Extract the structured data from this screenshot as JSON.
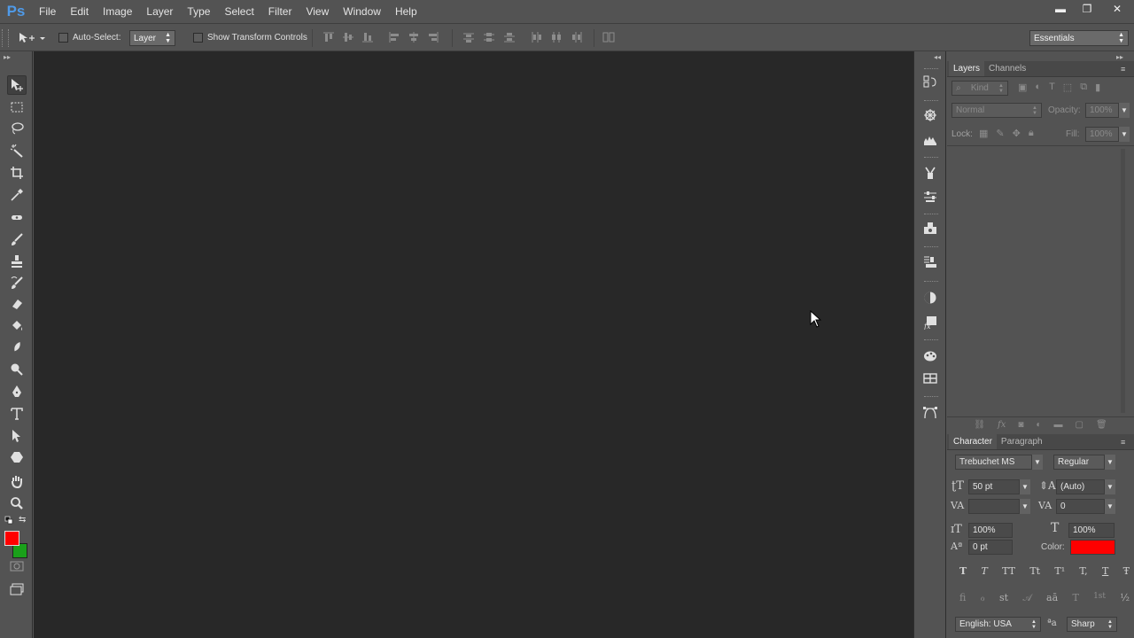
{
  "app": {
    "logo": "Ps"
  },
  "menu": [
    "File",
    "Edit",
    "Image",
    "Layer",
    "Type",
    "Select",
    "Filter",
    "View",
    "Window",
    "Help"
  ],
  "window_controls": {
    "minimize": "▬",
    "restore": "❐",
    "close": "✕"
  },
  "options_bar": {
    "auto_select_label": "Auto-Select:",
    "auto_select_value": "Layer",
    "transform_label": "Show Transform Controls",
    "workspace": "Essentials"
  },
  "layers_panel": {
    "tabs": [
      "Layers",
      "Channels"
    ],
    "kind_label": "Kind",
    "blend_mode": "Normal",
    "opacity_label": "Opacity:",
    "opacity_value": "100%",
    "lock_label": "Lock:",
    "fill_label": "Fill:",
    "fill_value": "100%"
  },
  "character_panel": {
    "tabs": [
      "Character",
      "Paragraph"
    ],
    "font_family": "Trebuchet MS",
    "font_style": "Regular",
    "font_size": "50 pt",
    "leading": "(Auto)",
    "kerning": "",
    "tracking": "0",
    "vertical_scale": "100%",
    "horizontal_scale": "100%",
    "baseline_shift": "0 pt",
    "color_label": "Color:",
    "text_color": "#ff0000",
    "type_buttons": [
      "T",
      "T",
      "TT",
      "Tt",
      "T¹",
      "T,",
      "T",
      "Ŧ"
    ],
    "opentype_buttons": [
      "fi",
      "ℴ",
      "st",
      "𝒜",
      "aā",
      "T",
      "1st",
      "½"
    ],
    "language": "English: USA",
    "antialias_icon": "ªa",
    "antialias": "Sharp"
  },
  "colors": {
    "foreground": "#ff0000",
    "background": "#1aa01a",
    "accent": "#4f9ae8"
  }
}
